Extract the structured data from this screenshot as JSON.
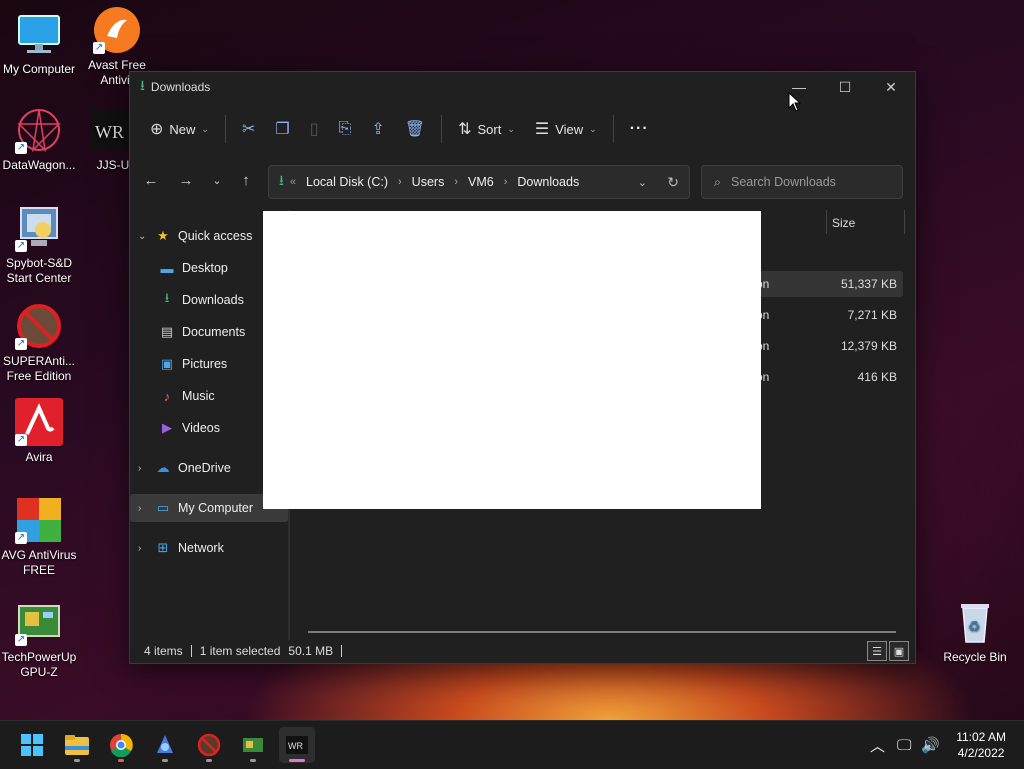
{
  "desktop": {
    "icons": [
      {
        "label": "My Computer",
        "icon": "monitor-icon"
      },
      {
        "label": "Avast Free Antivir",
        "icon": "avast-icon"
      },
      {
        "label": "DataWagon...",
        "icon": "datawagon-icon"
      },
      {
        "label": "JJS-U",
        "icon": "jjs-icon"
      },
      {
        "label": "Spybot-S&D Start Center",
        "icon": "spybot-icon"
      },
      {
        "label": "SUPERAnti... Free Edition",
        "icon": "superantispyware-icon"
      },
      {
        "label": "Avira",
        "icon": "avira-icon"
      },
      {
        "label": "AVG AntiVirus FREE",
        "icon": "avg-icon"
      },
      {
        "label": "TechPowerUp GPU-Z",
        "icon": "gpuz-icon"
      },
      {
        "label": "Recycle Bin",
        "icon": "recycle-bin-icon"
      }
    ]
  },
  "window": {
    "title": "Downloads",
    "toolbar": {
      "new_label": "New",
      "sort_label": "Sort",
      "view_label": "View",
      "more_label": "···"
    },
    "address": {
      "prefix": "«",
      "crumbs": [
        "Local Disk (C:)",
        "Users",
        "VM6",
        "Downloads"
      ]
    },
    "search": {
      "placeholder": "Search Downloads"
    },
    "nav": {
      "quick_access": "Quick access",
      "desktop": "Desktop",
      "downloads": "Downloads",
      "documents": "Documents",
      "pictures": "Pictures",
      "music": "Music",
      "videos": "Videos",
      "onedrive": "OneDrive",
      "my_computer": "My Computer",
      "network": "Network"
    },
    "columns": {
      "size": "Size"
    },
    "files": [
      {
        "type": "on",
        "size": "51,337 KB"
      },
      {
        "type": "on",
        "size": "7,271 KB"
      },
      {
        "type": "on",
        "size": "12,379 KB"
      },
      {
        "type": "on",
        "size": "416 KB"
      }
    ],
    "status": {
      "items": "4 items",
      "selected": "1 item selected",
      "sel_size": "50.1 MB"
    }
  },
  "taskbar": {
    "time": "11:02 AM",
    "date": "4/2/2022"
  }
}
